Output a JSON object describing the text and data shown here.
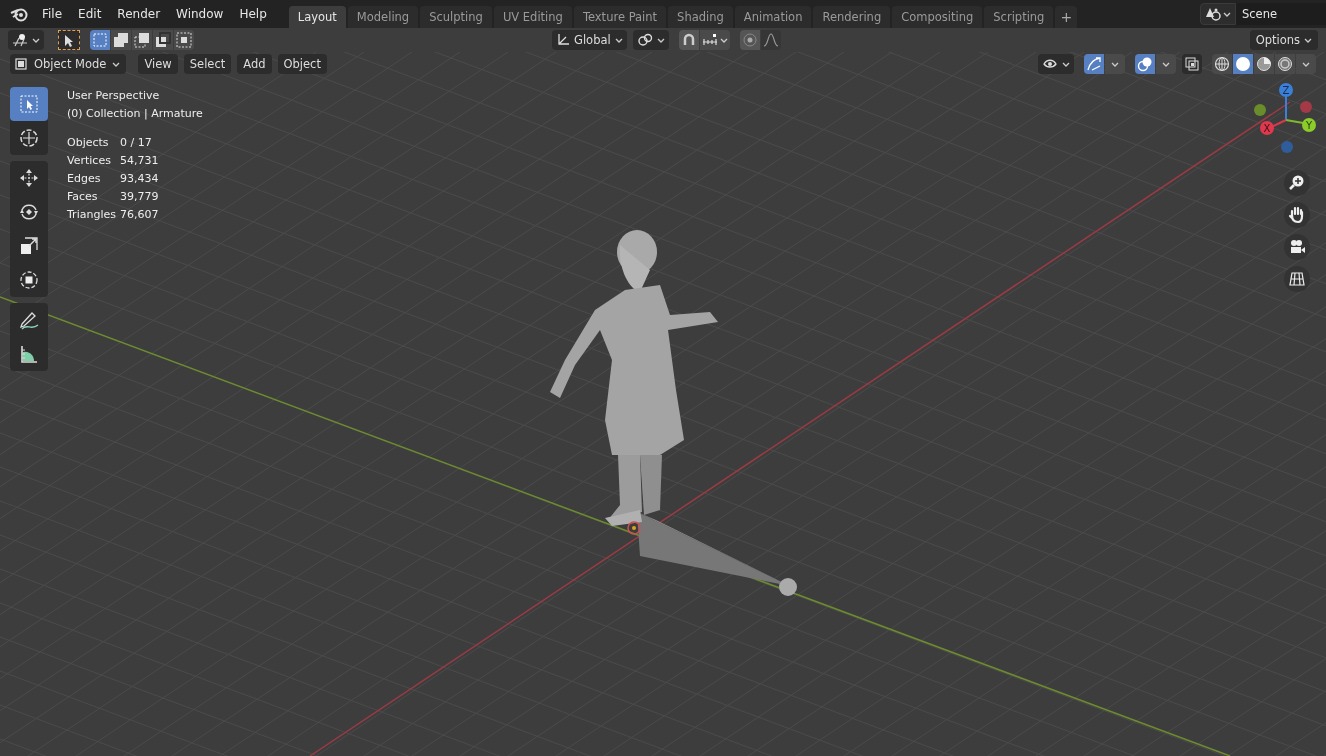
{
  "menu": [
    "File",
    "Edit",
    "Render",
    "Window",
    "Help"
  ],
  "workspaces": [
    {
      "label": "Layout",
      "selected": true
    },
    {
      "label": "Modeling",
      "selected": false
    },
    {
      "label": "Sculpting",
      "selected": false
    },
    {
      "label": "UV Editing",
      "selected": false
    },
    {
      "label": "Texture Paint",
      "selected": false
    },
    {
      "label": "Shading",
      "selected": false
    },
    {
      "label": "Animation",
      "selected": false
    },
    {
      "label": "Rendering",
      "selected": false
    },
    {
      "label": "Compositing",
      "selected": false
    },
    {
      "label": "Scripting",
      "selected": false
    }
  ],
  "add_workspace": "+",
  "scene": "Scene",
  "tool_header": {
    "select_modes": [
      {
        "selected": true
      },
      {
        "selected": false
      },
      {
        "selected": false
      },
      {
        "selected": false
      },
      {
        "selected": false
      }
    ],
    "orientation": "Global",
    "options": "Options"
  },
  "viewport_header": {
    "mode": "Object Mode",
    "menus": [
      "View",
      "Select",
      "Add",
      "Object"
    ],
    "gizmos_on": true,
    "overlays_on": true,
    "shading": [
      {
        "selected": false
      },
      {
        "selected": true
      },
      {
        "selected": false
      },
      {
        "selected": false
      }
    ]
  },
  "tools": [
    {
      "kind": "select",
      "selected": true
    },
    {
      "kind": "cursor",
      "selected": false
    },
    {
      "kind": "move",
      "selected": false
    },
    {
      "kind": "rotate",
      "selected": false
    },
    {
      "kind": "scale",
      "selected": false
    },
    {
      "kind": "transform",
      "selected": false
    },
    {
      "kind": "annotate",
      "selected": false
    },
    {
      "kind": "measure",
      "selected": false
    }
  ],
  "overlay": {
    "title": "User Perspective",
    "subtitle": "(0) Collection | Armature",
    "stats": [
      {
        "label": "Objects",
        "value": "0 / 17"
      },
      {
        "label": "Vertices",
        "value": "54,731"
      },
      {
        "label": "Edges",
        "value": "93,434"
      },
      {
        "label": "Faces",
        "value": "39,779"
      },
      {
        "label": "Triangles",
        "value": "76,607"
      }
    ]
  },
  "gizmo": {
    "x": "X",
    "y": "Y",
    "z": "Z"
  }
}
